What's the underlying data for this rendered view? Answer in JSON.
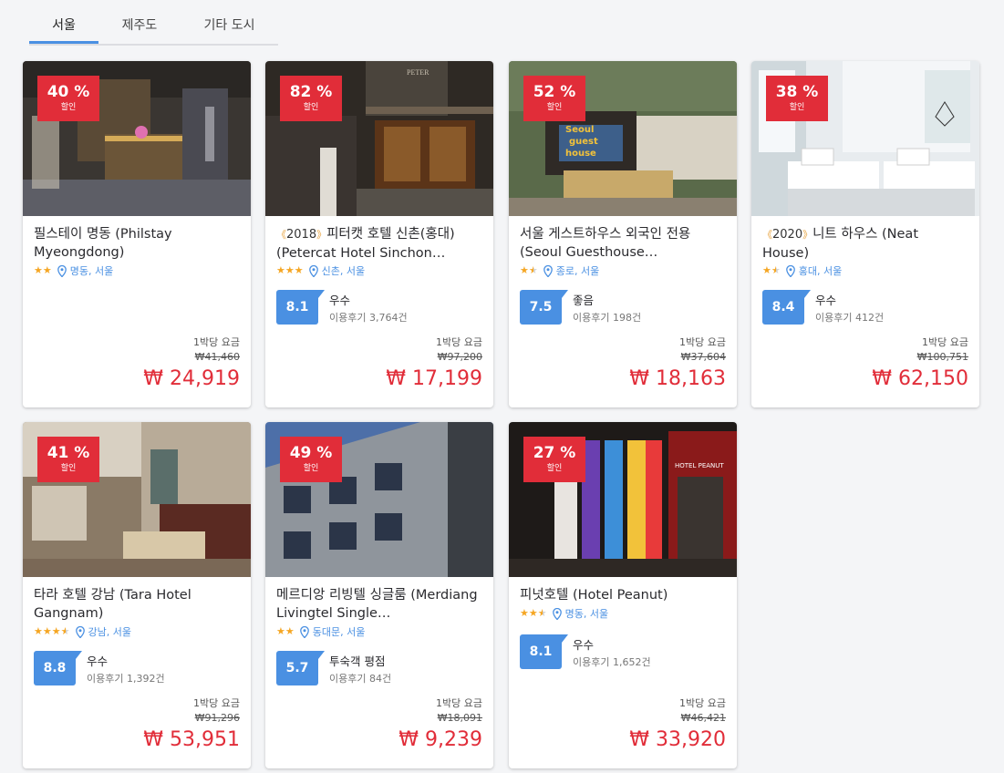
{
  "tabs": [
    {
      "label": "서울",
      "active": true
    },
    {
      "label": "제주도",
      "active": false
    },
    {
      "label": "기타 도시",
      "active": false
    }
  ],
  "colors": {
    "accent": "#4a90e2",
    "discount": "#e12d39",
    "star": "#f5a623"
  },
  "discount_label": "할인",
  "price_label": "1박당 요금",
  "hotels": [
    {
      "discount": "40 %",
      "year": "",
      "name": "필스테이 명동 (Philstay Myeongdong)",
      "stars": 2,
      "location": "명동, 서울",
      "score": "",
      "grade": "",
      "reviews": "",
      "orig_price": "₩41,460",
      "price": "₩ 24,919"
    },
    {
      "discount": "82 %",
      "year": "2018",
      "name": "피터캣 호텔 신촌(홍대) (Petercat Hotel Sinchon…",
      "stars": 3,
      "location": "신촌, 서울",
      "score": "8.1",
      "grade": "우수",
      "reviews": "이용후기 3,764건",
      "orig_price": "₩97,200",
      "price": "₩ 17,199"
    },
    {
      "discount": "52 %",
      "year": "",
      "name": "서울 게스트하우스 외국인 전용 (Seoul Guesthouse…",
      "stars": 1.5,
      "location": "종로, 서울",
      "score": "7.5",
      "grade": "좋음",
      "reviews": "이용후기 198건",
      "orig_price": "₩37,604",
      "price": "₩ 18,163"
    },
    {
      "discount": "38 %",
      "year": "2020",
      "name": "니트 하우스 (Neat House)",
      "stars": 1.5,
      "location": "홍대, 서울",
      "score": "8.4",
      "grade": "우수",
      "reviews": "이용후기 412건",
      "orig_price": "₩100,751",
      "price": "₩ 62,150"
    },
    {
      "discount": "41 %",
      "year": "",
      "name": "타라 호텔 강남 (Tara Hotel Gangnam)",
      "stars": 3.5,
      "location": "강남, 서울",
      "score": "8.8",
      "grade": "우수",
      "reviews": "이용후기 1,392건",
      "orig_price": "₩91,296",
      "price": "₩ 53,951"
    },
    {
      "discount": "49 %",
      "year": "",
      "name": "메르디앙 리빙텔 싱글룸 (Merdiang Livingtel Single…",
      "stars": 2,
      "location": "동대문, 서울",
      "score": "5.7",
      "grade": "투숙객 평점",
      "reviews": "이용후기 84건",
      "orig_price": "₩18,091",
      "price": "₩ 9,239"
    },
    {
      "discount": "27 %",
      "year": "",
      "name": "피넛호텔 (Hotel Peanut)",
      "stars": 2.5,
      "location": "명동, 서울",
      "score": "8.1",
      "grade": "우수",
      "reviews": "이용후기 1,652건",
      "orig_price": "₩46,421",
      "price": "₩ 33,920"
    }
  ]
}
